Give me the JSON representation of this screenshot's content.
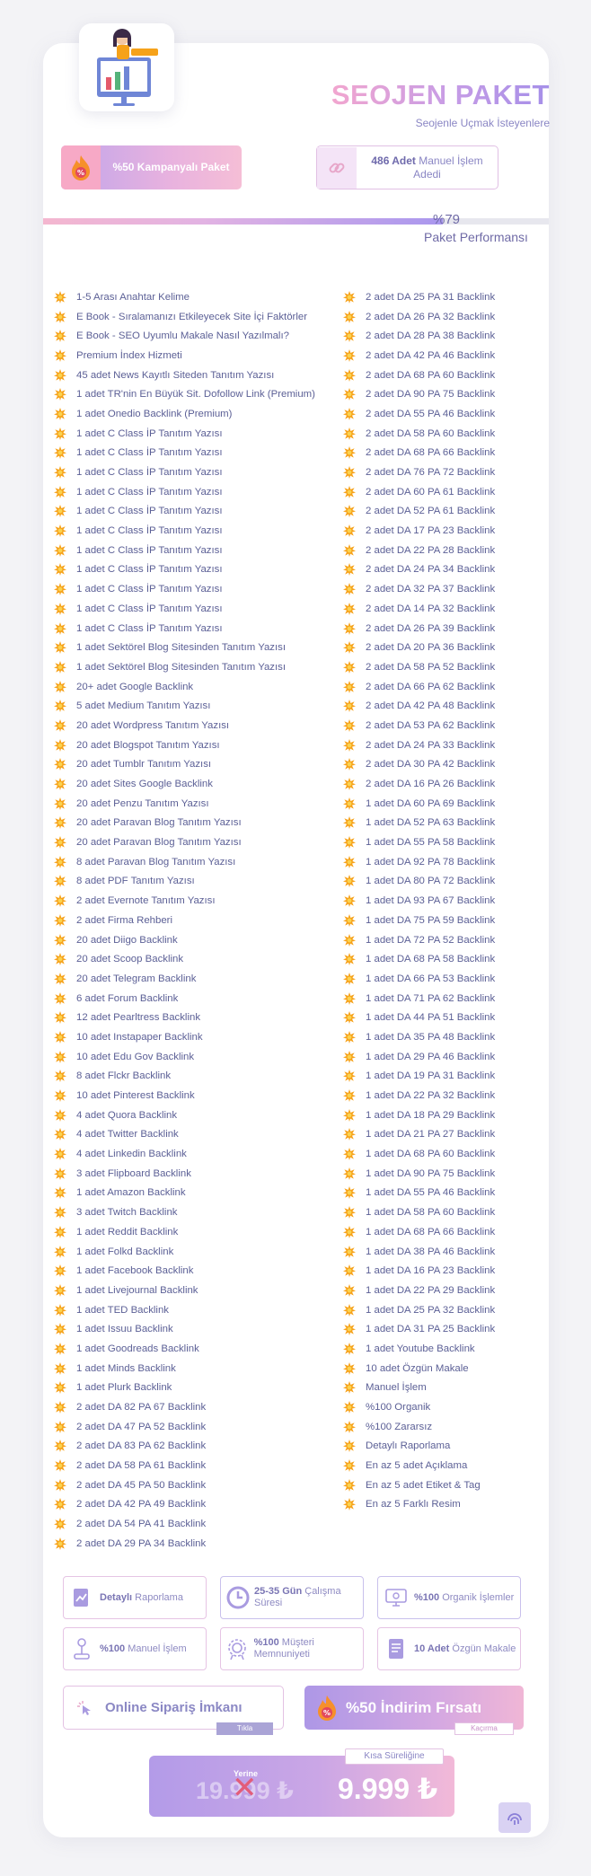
{
  "header": {
    "title": "SEOJEN PAKET",
    "subtitle": "Seojenle Uçmak İsteyenlere"
  },
  "promo": {
    "label": "%50 Kampanyalı Paket"
  },
  "operations": {
    "count": "486 Adet",
    "label": "Manuel İşlem Adedi"
  },
  "performance": {
    "value": "%79",
    "label": "Paket Performansı",
    "progress": 0.79
  },
  "items_left": [
    "1-5 Arası Anahtar Kelime",
    "E Book - Sıralamanızı Etkileyecek Site İçi Faktörler",
    "E Book - SEO Uyumlu Makale Nasıl Yazılmalı?",
    "Premium İndex Hizmeti",
    "45 adet News Kayıtlı Siteden Tanıtım Yazısı",
    "1 adet TR'nin En Büyük Sit. Dofollow Link (Premium)",
    "1 adet Onedio Backlink (Premium)",
    "1 adet C Class İP Tanıtım Yazısı",
    "1 adet C Class İP Tanıtım Yazısı",
    "1 adet C Class İP Tanıtım Yazısı",
    "1 adet C Class İP Tanıtım Yazısı",
    "1 adet C Class İP Tanıtım Yazısı",
    "1 adet C Class İP Tanıtım Yazısı",
    "1 adet C Class İP Tanıtım Yazısı",
    "1 adet C Class İP Tanıtım Yazısı",
    "1 adet C Class İP Tanıtım Yazısı",
    "1 adet C Class İP Tanıtım Yazısı",
    "1 adet C Class İP Tanıtım Yazısı",
    "1 adet Sektörel Blog Sitesinden Tanıtım Yazısı",
    "1 adet Sektörel Blog Sitesinden Tanıtım Yazısı",
    "20+ adet Google Backlink",
    "5 adet Medium Tanıtım Yazısı",
    "20 adet Wordpress Tanıtım Yazısı",
    "20 adet Blogspot Tanıtım Yazısı",
    "20 adet Tumblr Tanıtım Yazısı",
    "20 adet Sites Google Backlink",
    "20 adet Penzu Tanıtım Yazısı",
    "20 adet Paravan Blog Tanıtım Yazısı",
    "20 adet Paravan Blog Tanıtım Yazısı",
    "8 adet Paravan Blog Tanıtım Yazısı",
    "8 adet PDF Tanıtım Yazısı",
    "2 adet Evernote Tanıtım Yazısı",
    "2 adet Firma Rehberi",
    "20 adet Diigo Backlink",
    "20 adet Scoop Backlink",
    "20 adet Telegram Backlink",
    "6 adet Forum Backlink",
    "12 adet Pearltress Backlink",
    "10 adet Instapaper Backlink",
    "10 adet Edu Gov Backlink",
    "8 adet Flckr Backlink",
    "10 adet Pinterest Backlink",
    "4 adet Quora Backlink",
    "4 adet Twitter Backlink",
    "4 adet Linkedin Backlink",
    "3 adet Flipboard Backlink",
    "1 adet Amazon Backlink",
    "3 adet Twitch Backlink",
    "1 adet Reddit Backlink",
    "1 adet Folkd Backlink",
    "1 adet Facebook Backlink",
    "1 adet Livejournal Backlink",
    "1 adet TED Backlink",
    "1 adet Issuu Backlink",
    "1 adet Goodreads Backlink",
    "1 adet Minds Backlink",
    "1 adet Plurk Backlink",
    "2 adet DA 82 PA 67 Backlink",
    "2 adet DA 47 PA 52 Backlink",
    "2 adet DA 83 PA 62 Backlink",
    "2 adet DA 58 PA 61 Backlink",
    "2 adet DA 45 PA 50 Backlink",
    "2 adet DA 42 PA 49 Backlink",
    "2 adet DA 54 PA 41 Backlink",
    "2 adet DA 29 PA 34 Backlink"
  ],
  "items_right": [
    "2 adet DA 25 PA 31 Backlink",
    "2 adet DA 26 PA 32 Backlink",
    "2 adet DA 28 PA 38 Backlink",
    "2 adet DA 42 PA 46 Backlink",
    "2 adet DA 68 PA 60 Backlink",
    "2 adet DA 90 PA 75 Backlink",
    "2 adet DA 55 PA 46 Backlink",
    "2 adet DA 58 PA 60 Backlink",
    "2 adet DA 68 PA 66 Backlink",
    "2 adet DA 76 PA 72 Backlink",
    "2 adet DA 60 PA 61 Backlink",
    "2 adet DA 52 PA 61 Backlink",
    "2 adet DA 17 PA 23 Backlink",
    "2 adet DA 22 PA 28 Backlink",
    "2 adet DA 24 PA 34 Backlink",
    "2 adet DA 32 PA 37 Backlink",
    "2 adet DA 14 PA 32 Backlink",
    "2 adet DA 26 PA 39 Backlink",
    "2 adet DA 20 PA 36 Backlink",
    "2 adet DA 58 PA 52 Backlink",
    "2 adet DA 66 PA 62 Backlink",
    "2 adet DA 42 PA 48 Backlink",
    "2 adet DA 53 PA 62 Backlink",
    "2 adet DA 24 PA 33 Backlink",
    "2 adet DA 30 PA 42 Backlink",
    "2 adet DA 16 PA 26 Backlink",
    "1 adet DA 60 PA 69 Backlink",
    "1 adet DA 52 PA 63 Backlink",
    "1 adet DA 55 PA 58 Backlink",
    "1 adet DA 92 PA 78 Backlink",
    "1 adet DA 80 PA 72 Backlink",
    "1 adet DA 93 PA 67 Backlink",
    "1 adet DA 75 PA 59 Backlink",
    "1 adet DA 72 PA 52 Backlink",
    "1 adet DA 68 PA 58 Backlink",
    "1 adet DA 66 PA 53 Backlink",
    "1 adet DA 71 PA 62 Backlink",
    "1 adet DA 44 PA 51 Backlink",
    "1 adet DA 35 PA 48 Backlink",
    "1 adet DA 29 PA 46 Backlink",
    "1 adet DA 19 PA 31 Backlink",
    "1 adet DA 22 PA 32 Backlink",
    "1 adet DA 18 PA 29 Backlink",
    "1 adet DA 21 PA 27 Backlink",
    "1 adet DA 68 PA 60 Backlink",
    "1 adet DA 90 PA 75 Backlink",
    "1 adet DA 55 PA 46 Backlink",
    "1 adet DA 58 PA 60 Backlink",
    "1 adet DA 68 PA 66 Backlink",
    "1 adet DA 38 PA 46 Backlink",
    "1 adet DA 16 PA 23 Backlink",
    "1 adet DA 22 PA 29 Backlink",
    "1 adet DA 25 PA 32 Backlink",
    "1 adet DA 31 PA 25 Backlink",
    "1 adet Youtube Backlink",
    "10 adet Özgün Makale",
    "Manuel İşlem",
    "%100 Organik",
    "%100 Zararsız",
    "Detaylı Raporlama",
    "En az 5 adet Açıklama",
    "En az 5 adet Etiket & Tag",
    "En az 5 Farklı Resim"
  ],
  "features": [
    {
      "bold": "Detaylı",
      "rest": "Raporlama",
      "icon": "report-icon"
    },
    {
      "bold": "25-35 Gün",
      "rest": "Çalışma Süresi",
      "icon": "clock-icon"
    },
    {
      "bold": "%100",
      "rest": "Organik İşlemler",
      "icon": "monitor-icon"
    },
    {
      "bold": "%100",
      "rest": "Manuel İşlem",
      "icon": "joystick-icon"
    },
    {
      "bold": "%100",
      "rest": "Müşteri Memnuniyeti",
      "icon": "badge-icon"
    },
    {
      "bold": "10 Adet",
      "rest": "Özgün Makale",
      "icon": "document-icon"
    }
  ],
  "cta_order": {
    "label": "Online Sipariş İmkanı",
    "tag": "Tıkla"
  },
  "cta_discount": {
    "label": "%50 İndirim Fırsatı",
    "tag": "Kaçırma"
  },
  "price": {
    "old": "19.999 ₺",
    "old_marker": "Yerine",
    "new": "9.999 ₺",
    "tag": "Kısa Süreliğine"
  },
  "colors": {
    "accent_purple": "#a58fe8",
    "accent_pink": "#f2a6cf",
    "text": "#5c6096",
    "star": "#f6a21a"
  }
}
